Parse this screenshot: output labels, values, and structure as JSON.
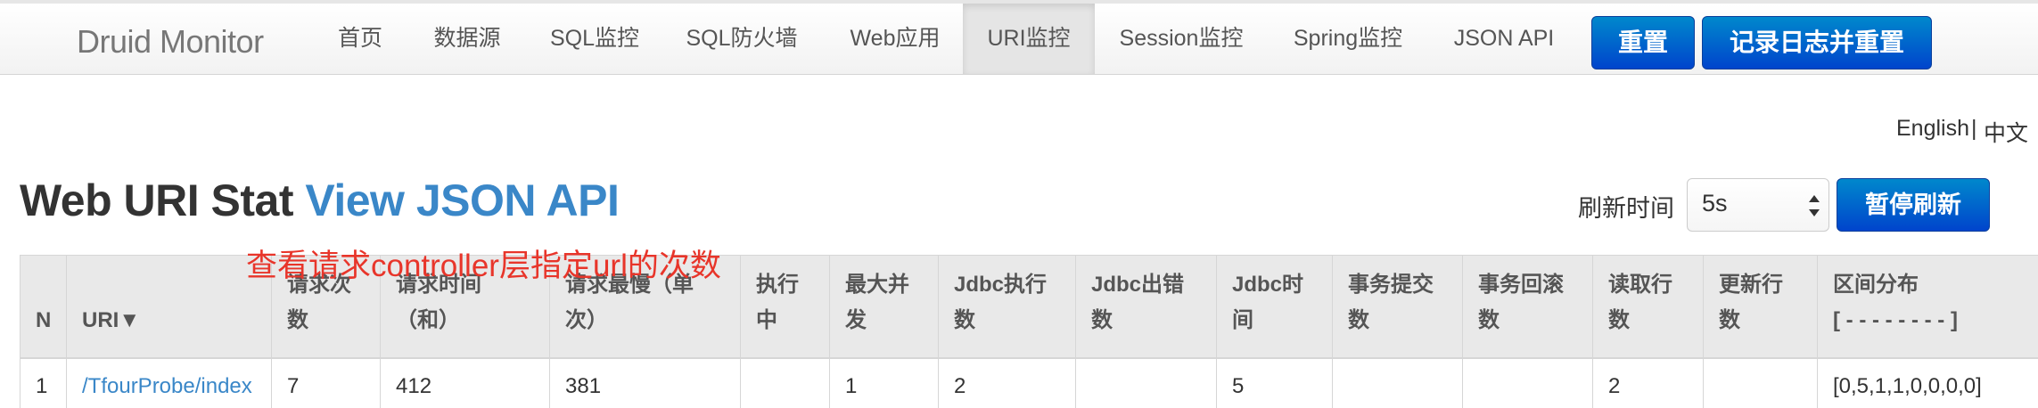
{
  "navbar": {
    "brand": "Druid Monitor",
    "items": [
      "首页",
      "数据源",
      "SQL监控",
      "SQL防火墙",
      "Web应用",
      "URI监控",
      "Session监控",
      "Spring监控",
      "JSON API"
    ],
    "active": "URI监控",
    "buttons": {
      "reset": "重置",
      "log_and_reset": "记录日志并重置"
    }
  },
  "lang": {
    "english": "English",
    "separator": "|",
    "chinese": "中文"
  },
  "page": {
    "title": "Web URI Stat",
    "api_link": "View JSON API",
    "annotation": "查看请求controller层指定url的次数",
    "refresh_label": "刷新时间",
    "refresh_value": "5s",
    "pause_button": "暂停刷新"
  },
  "table": {
    "columns": [
      {
        "l1": "N",
        "l2": ""
      },
      {
        "l1": "URI▼",
        "l2": ""
      },
      {
        "l1": "请求次",
        "l2": "数"
      },
      {
        "l1": "请求时间",
        "l2": "（和）"
      },
      {
        "l1": "请求最慢（单",
        "l2": "次）"
      },
      {
        "l1": "执行",
        "l2": "中"
      },
      {
        "l1": "最大并",
        "l2": "发"
      },
      {
        "l1": "Jdbc执行",
        "l2": "数"
      },
      {
        "l1": "Jdbc出错",
        "l2": "数"
      },
      {
        "l1": "Jdbc时",
        "l2": "间"
      },
      {
        "l1": "事务提交",
        "l2": "数"
      },
      {
        "l1": "事务回滚",
        "l2": "数"
      },
      {
        "l1": "读取行",
        "l2": "数"
      },
      {
        "l1": "更新行",
        "l2": "数"
      },
      {
        "l1": "区间分布",
        "l2": "[ - - - - - - - - ]"
      }
    ],
    "rows": [
      [
        "1",
        "/TfourProbe/index",
        "7",
        "412",
        "381",
        "",
        "1",
        "2",
        "",
        "5",
        "",
        "",
        "2",
        "",
        "[0,5,1,1,0,0,0,0]"
      ]
    ]
  }
}
